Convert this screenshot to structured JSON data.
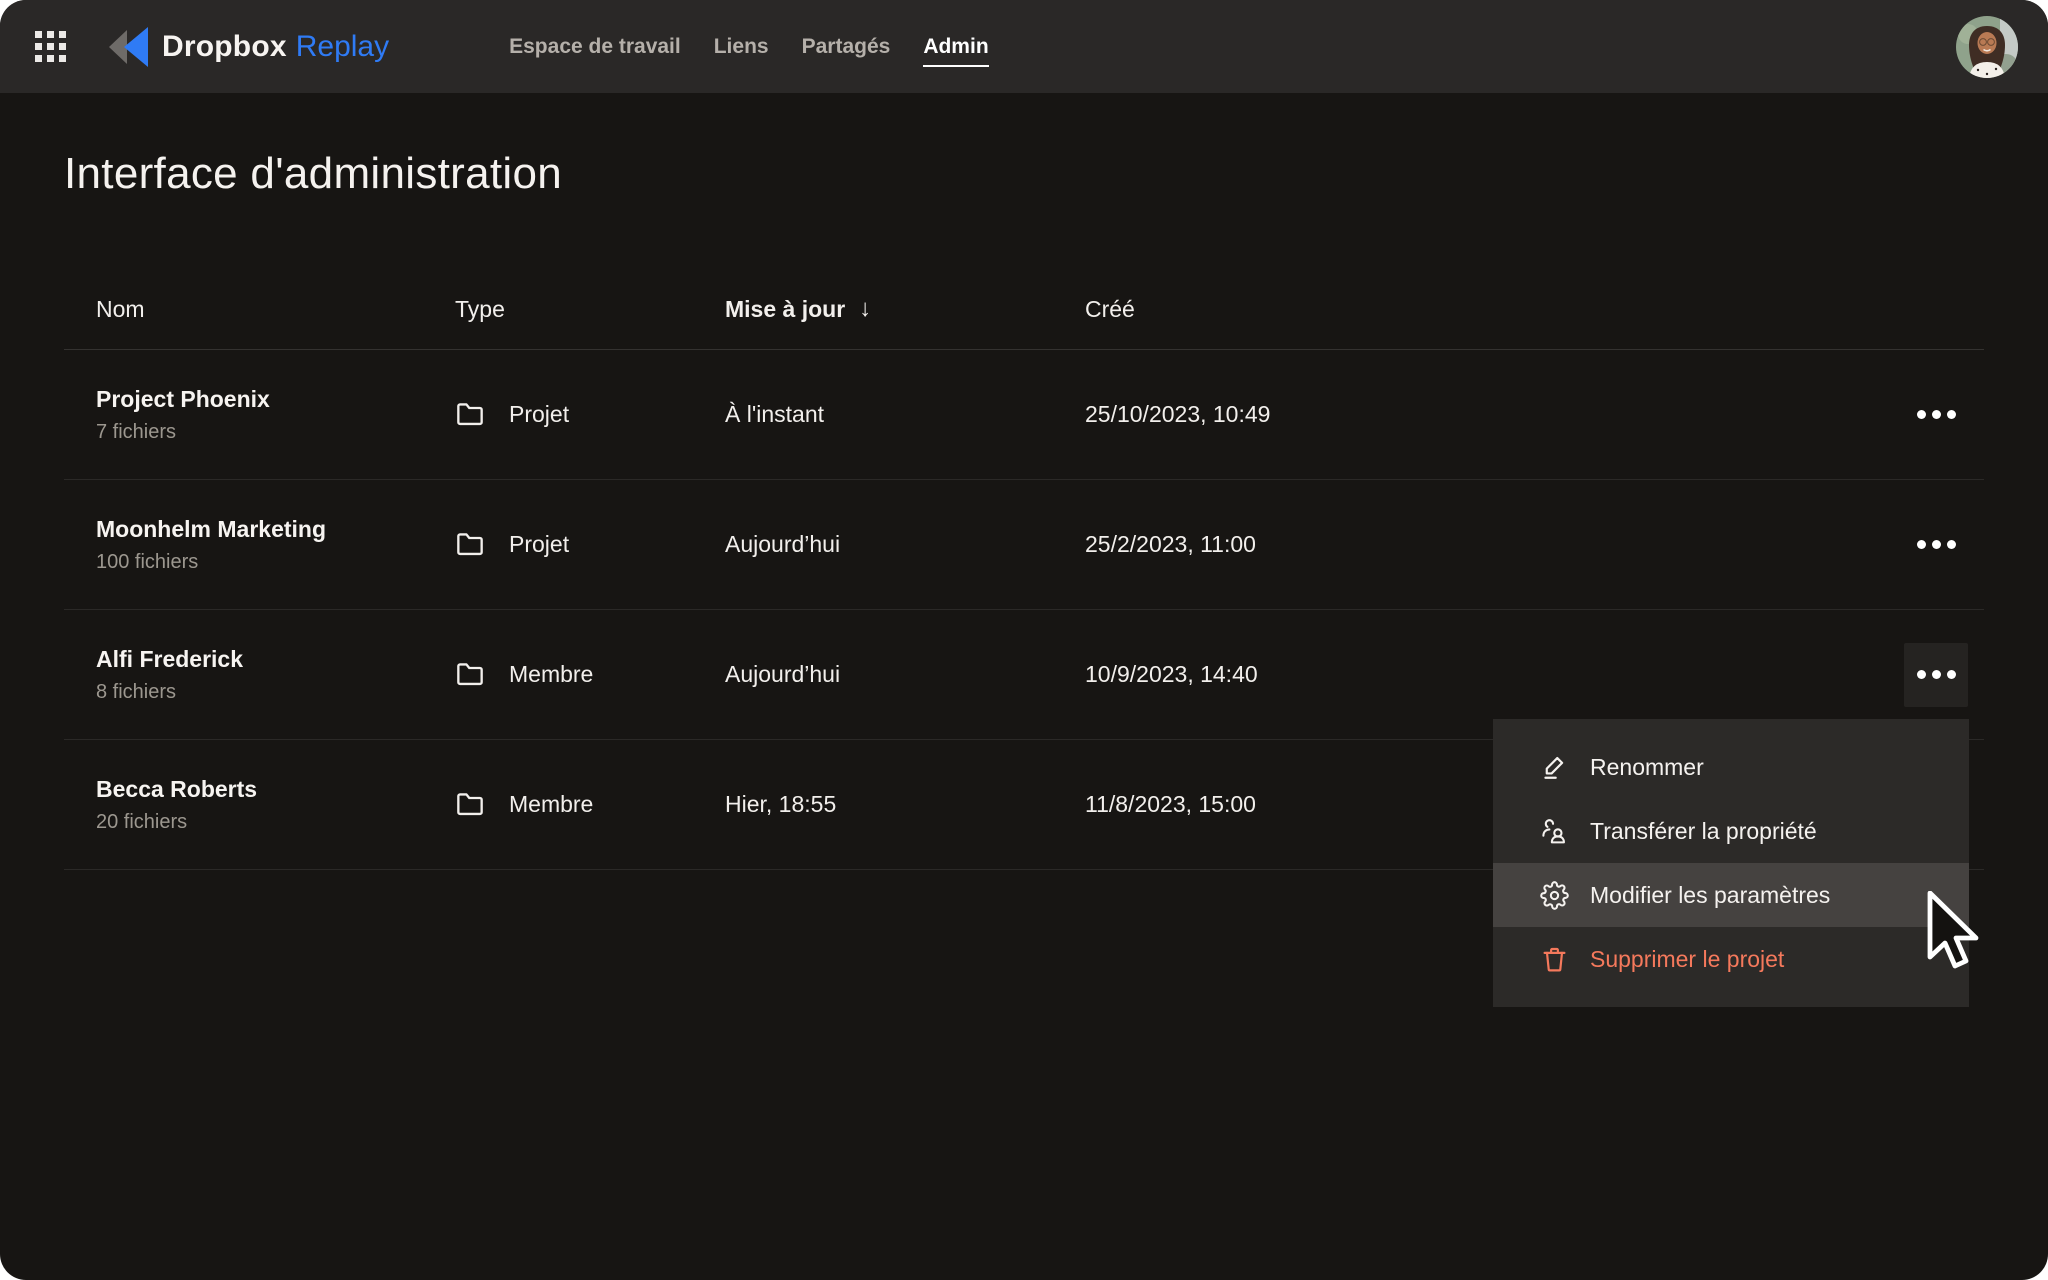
{
  "nav": {
    "logo": {
      "brand": "Dropbox",
      "product": "Replay"
    },
    "items": [
      {
        "label": "Espace de travail",
        "active": false
      },
      {
        "label": "Liens",
        "active": false
      },
      {
        "label": "Partagés",
        "active": false
      },
      {
        "label": "Admin",
        "active": true
      }
    ]
  },
  "page": {
    "title": "Interface d'administration"
  },
  "table": {
    "columns": [
      {
        "label": "Nom"
      },
      {
        "label": "Type"
      },
      {
        "label": "Mise à jour",
        "sorted": true,
        "sort_icon": "arrow-down",
        "sort_glyph": "↓"
      },
      {
        "label": "Créé"
      }
    ],
    "rows": [
      {
        "name": "Project Phoenix",
        "files": "7 fichiers",
        "type": "Projet",
        "updated": "À l'instant",
        "created": "25/10/2023, 10:49"
      },
      {
        "name": "Moonhelm Marketing",
        "files": "100 fichiers",
        "type": "Projet",
        "updated": "Aujourd’hui",
        "created": "25/2/2023, 11:00"
      },
      {
        "name": "Alfi Frederick",
        "files": "8 fichiers",
        "type": "Membre",
        "updated": "Aujourd’hui",
        "created": "10/9/2023, 14:40",
        "menu_open": true
      },
      {
        "name": "Becca Roberts",
        "files": "20 fichiers",
        "type": "Membre",
        "updated": "Hier, 18:55",
        "created": "11/8/2023, 15:00"
      }
    ]
  },
  "context_menu": {
    "items": [
      {
        "label": "Renommer",
        "icon": "pencil-icon"
      },
      {
        "label": "Transférer la propriété",
        "icon": "transfer-ownership-icon"
      },
      {
        "label": "Modifier les paramètres",
        "icon": "gear-icon",
        "highlighted": true
      },
      {
        "label": "Supprimer le projet",
        "icon": "trash-icon",
        "danger": true
      }
    ]
  },
  "colors": {
    "app_background": "#171513",
    "nav_background": "#2a2827",
    "accent_blue": "#2f7bf5",
    "danger_coral": "#f5795c",
    "menu_background": "#2c2a28",
    "menu_highlight": "#454240",
    "text_primary": "#f7f4f1",
    "text_secondary": "#9c978f"
  }
}
